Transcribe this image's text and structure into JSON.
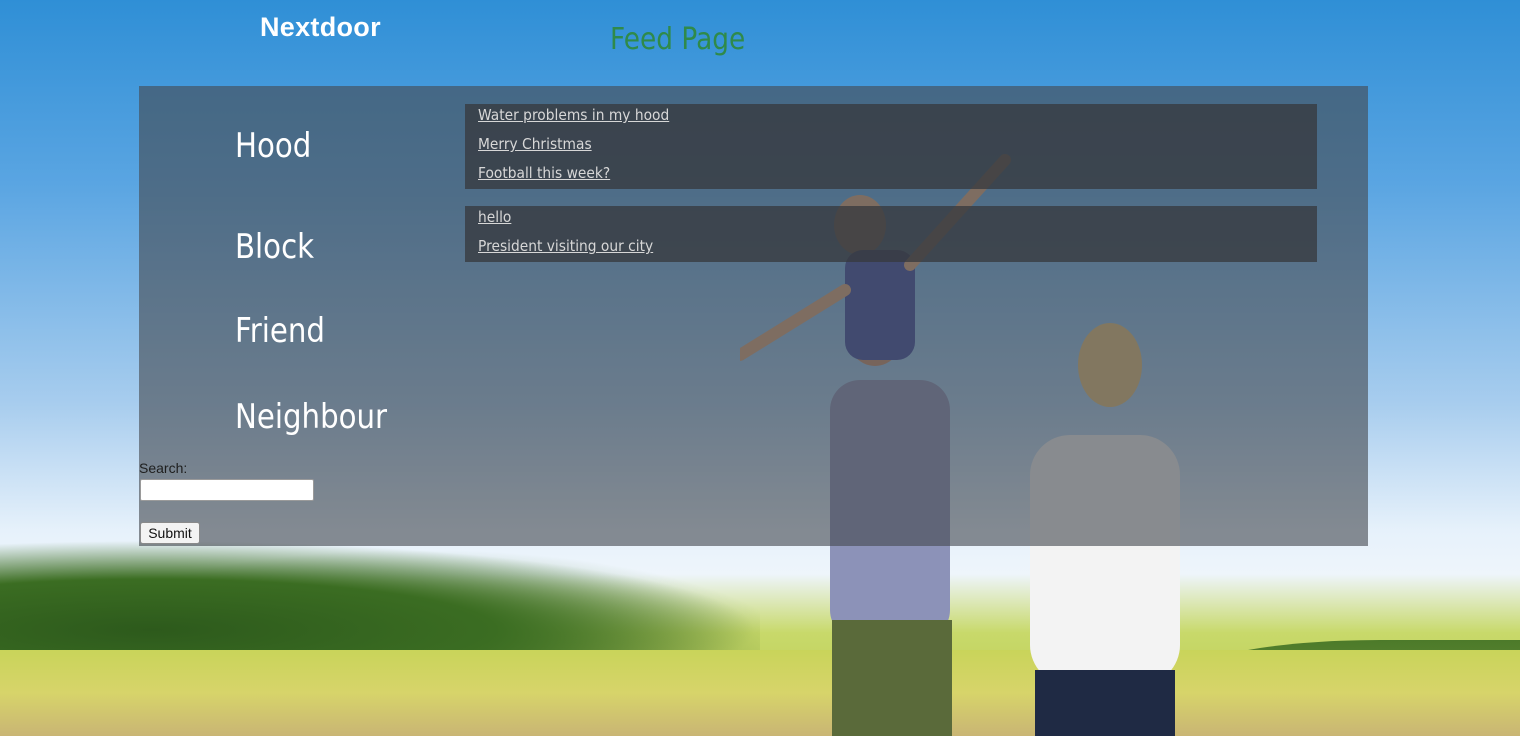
{
  "header": {
    "brand": "Nextdoor",
    "page_title": "Feed Page"
  },
  "nav": {
    "items": [
      {
        "label": "Hood"
      },
      {
        "label": "Block"
      },
      {
        "label": "Friend"
      },
      {
        "label": "Neighbour"
      }
    ]
  },
  "feeds": {
    "hood": [
      "Water problems in my hood",
      "Merry Christmas",
      "Football this week?"
    ],
    "block": [
      "hello",
      "President visiting our city"
    ]
  },
  "search": {
    "label": "Search:",
    "value": "",
    "submit_label": "Submit"
  },
  "colors": {
    "page_title": "#2f8a4a",
    "panel_overlay": "rgba(70,74,80,0.62)",
    "link_text": "#d7d7d7"
  }
}
